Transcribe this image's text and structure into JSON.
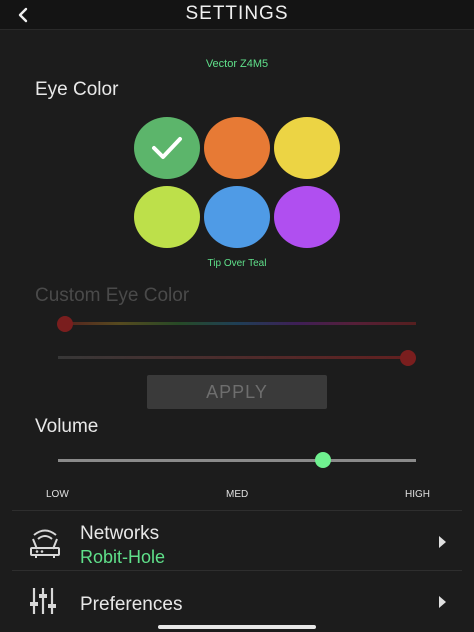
{
  "header": {
    "title": "SETTINGS"
  },
  "device": {
    "name": "Vector Z4M5"
  },
  "eye_color": {
    "label": "Eye Color",
    "selected_name": "Tip Over Teal",
    "swatches": [
      {
        "color": "#5cb56b",
        "selected": true
      },
      {
        "color": "#e77a35"
      },
      {
        "color": "#ecd444"
      },
      {
        "color": "#bde04a"
      },
      {
        "color": "#4f9be6"
      },
      {
        "color": "#b04ff0"
      }
    ]
  },
  "custom_eye_color": {
    "label": "Custom Eye Color",
    "apply_label": "APPLY"
  },
  "volume": {
    "label": "Volume",
    "level": 0.74,
    "low": "LOW",
    "med": "MED",
    "high": "HIGH"
  },
  "networks": {
    "title": "Networks",
    "value": "Robit-Hole",
    "icon": "router-icon"
  },
  "preferences": {
    "title": "Preferences",
    "icon": "sliders-icon"
  },
  "colors": {
    "accent": "#5fe08a",
    "slider_thumb": "#6ff08f"
  }
}
